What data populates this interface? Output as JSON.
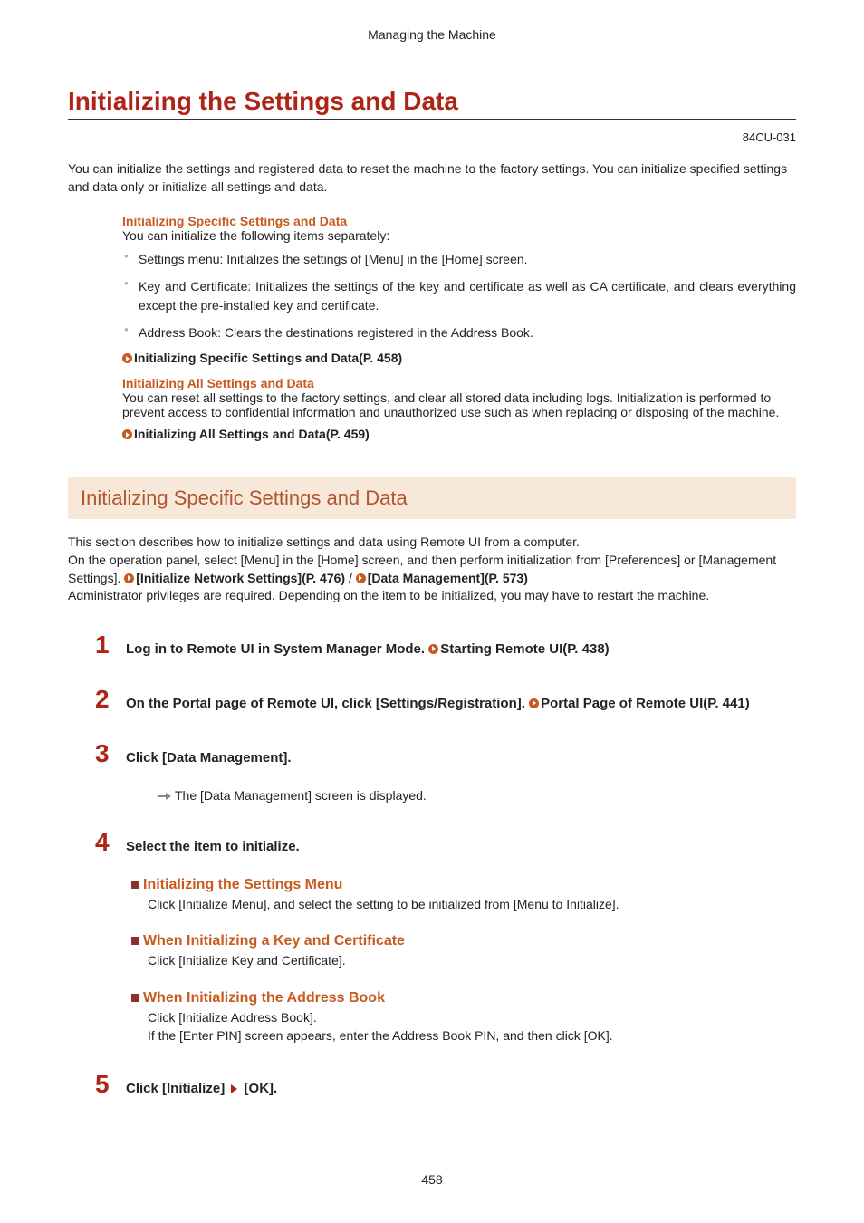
{
  "chapter": "Managing the Machine",
  "title": "Initializing the Settings and Data",
  "doc_id": "84CU-031",
  "intro": "You can initialize the settings and registered data to reset the machine to the factory settings. You can initialize specified settings and data only or initialize all settings and data.",
  "block1": {
    "head": "Initializing Specific Settings and Data",
    "lead": "You can initialize the following items separately:",
    "bullets": [
      "Settings menu: Initializes the settings of [Menu] in the [Home] screen.",
      "Key and Certificate: Initializes the settings of the key and certificate as well as CA certificate, and clears everything except the pre-installed key and certificate.",
      "Address Book: Clears the destinations registered in the Address Book."
    ],
    "xref": "Initializing Specific Settings and Data(P. 458)"
  },
  "block2": {
    "head": "Initializing All Settings and Data",
    "body": "You can reset all settings to the factory settings, and clear all stored data including logs. Initialization is performed to prevent access to confidential information and unauthorized use such as when replacing or disposing of the machine.",
    "xref": "Initializing All Settings and Data(P. 459)"
  },
  "section_bar": "Initializing Specific Settings and Data",
  "section_body": {
    "line1": "This section describes how to initialize settings and data using Remote UI from a computer.",
    "line2_pre": "On the operation panel, select [Menu] in the [Home] screen, and then perform initialization from [Preferences] or [Management Settings]. ",
    "xref1": "[Initialize Network Settings](P. 476)",
    "sep": "  /  ",
    "xref2": "[Data Management](P. 573)",
    "line3": "Administrator privileges are required. Depending on the item to be initialized, you may have to restart the machine."
  },
  "steps": {
    "s1": {
      "title_pre": "Log in to Remote UI in System Manager Mode. ",
      "xref": "Starting Remote UI(P. 438)"
    },
    "s2": {
      "title_pre": "On the Portal page of Remote UI, click [Settings/Registration]. ",
      "xref": "Portal Page of Remote UI(P. 441)"
    },
    "s3": {
      "title": "Click [Data Management].",
      "result": "The [Data Management] screen is displayed."
    },
    "s4": {
      "title": "Select the item to initialize.",
      "sub1": {
        "head": "Initializing the Settings Menu",
        "body": "Click [Initialize Menu], and select the setting to be initialized from [Menu to Initialize]."
      },
      "sub2": {
        "head": "When Initializing a Key and Certificate",
        "body": "Click [Initialize Key and Certificate]."
      },
      "sub3": {
        "head": "When Initializing the Address Book",
        "body1": "Click [Initialize Address Book].",
        "body2": "If the [Enter PIN] screen appears, enter the Address Book PIN, and then click [OK]."
      }
    },
    "s5": {
      "title_pre": "Click [Initialize] ",
      "title_post": " [OK]."
    }
  },
  "page_number": "458"
}
